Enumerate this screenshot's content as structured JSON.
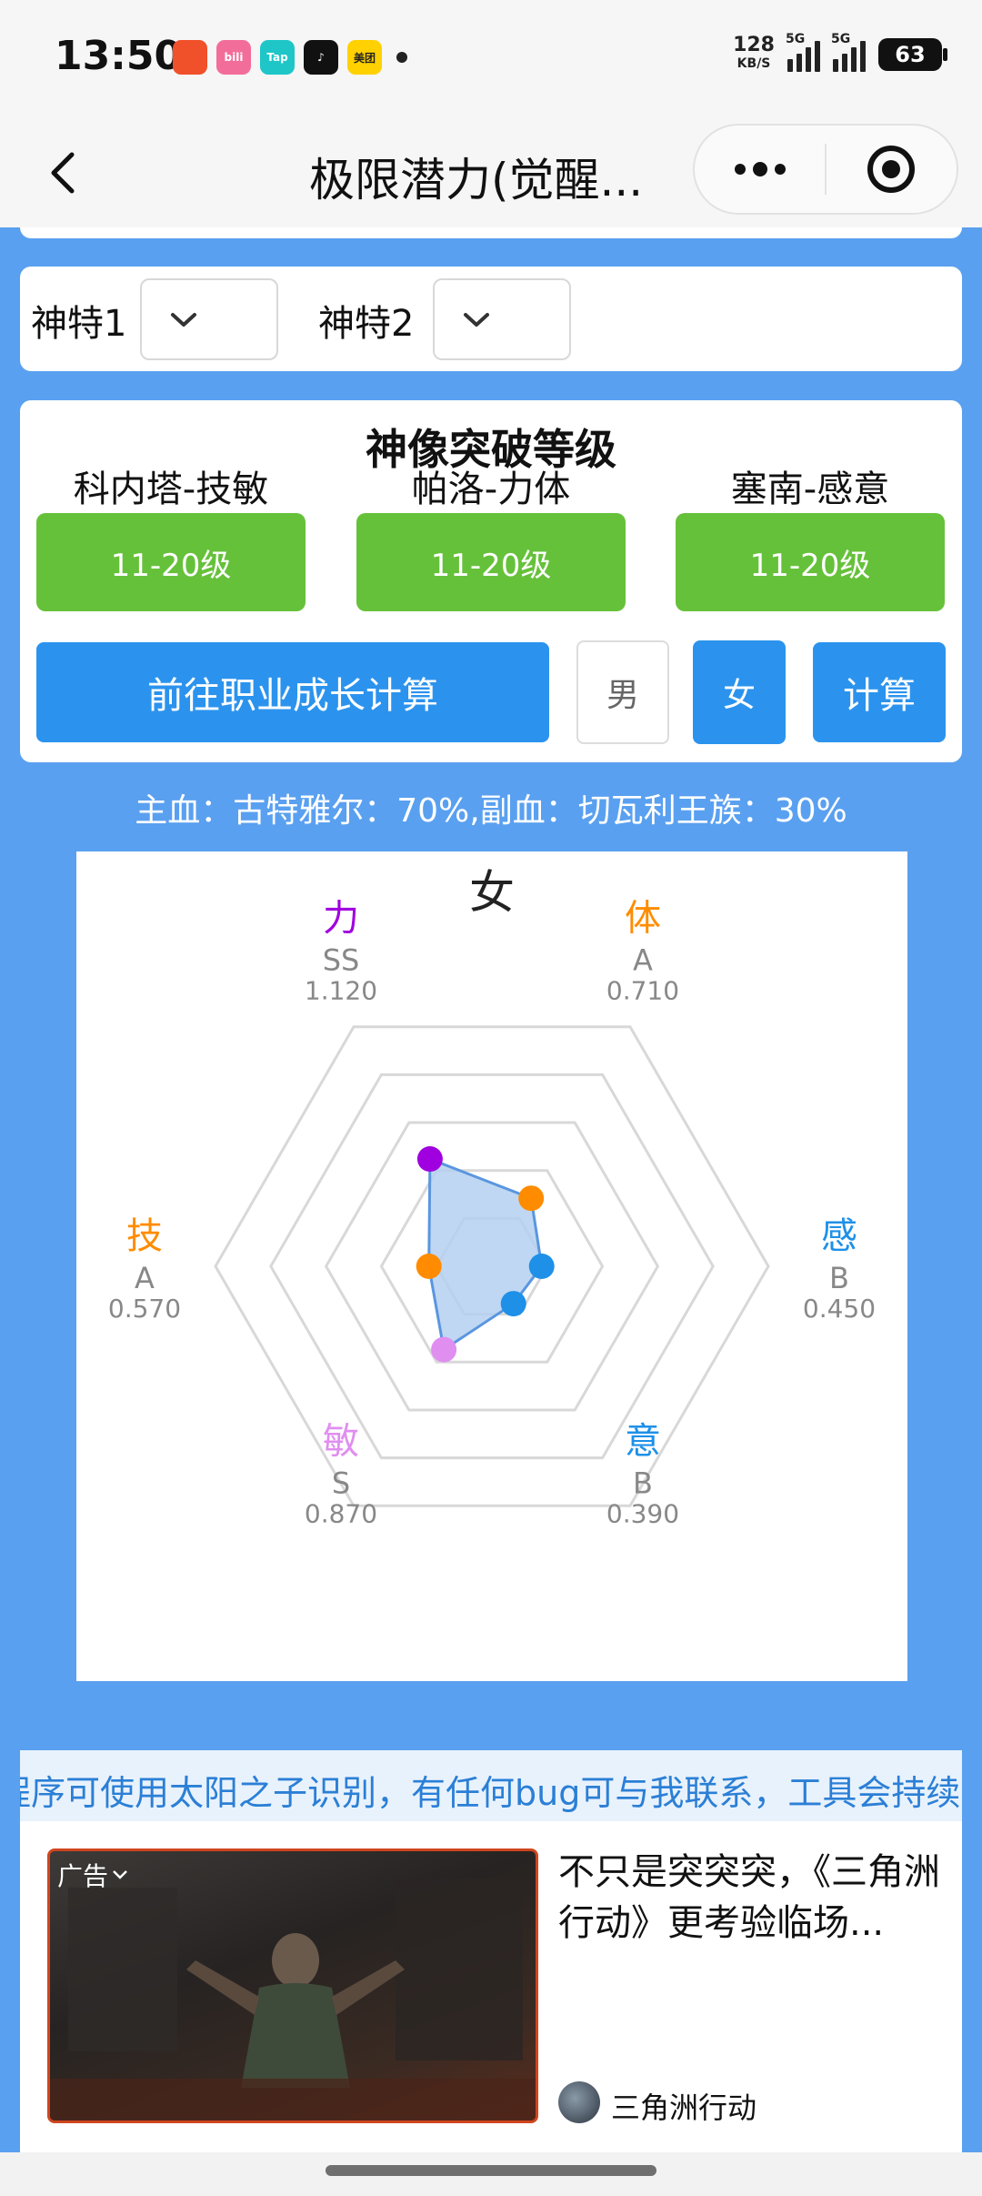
{
  "status_bar": {
    "time": "13:50",
    "apps": [
      {
        "name": "taobao-icon",
        "label": "",
        "color": "#f0502a"
      },
      {
        "name": "bilibili-icon",
        "label": "bili",
        "color": "#f36d9a"
      },
      {
        "name": "taptap-icon",
        "label": "Tap",
        "color": "#1ec6c8"
      },
      {
        "name": "douyin-icon",
        "label": "♪",
        "color": "#111111"
      },
      {
        "name": "meituan-icon",
        "label": "美团",
        "color": "#ffd100"
      }
    ],
    "net_speed_value": "128",
    "net_speed_unit": "KB/S",
    "signal1_tag": "5G",
    "signal2_tag": "5G",
    "battery": "63"
  },
  "title_bar": {
    "title": "极限潜力(觉醒..."
  },
  "gods": {
    "god1_label": "神特1",
    "god2_label": "神特2"
  },
  "statue_break": {
    "title": "神像突破等级",
    "statues": [
      {
        "name": "科内塔-技敏",
        "level": "11-20级"
      },
      {
        "name": "帕洛-力体",
        "level": "11-20级"
      },
      {
        "name": "塞南-感意",
        "level": "11-20级"
      }
    ],
    "career_button": "前往职业成长计算",
    "male": "男",
    "female": "女",
    "calc": "计算"
  },
  "bloodline": "主血：古特雅尔：70%,副血：切瓦利王族：30%",
  "chart_data": {
    "type": "radar",
    "title": "女",
    "axes": [
      {
        "label": "力",
        "grade": "SS",
        "value": 1.12,
        "value_text": "1.120",
        "color": "#a000e0"
      },
      {
        "label": "体",
        "grade": "A",
        "value": 0.71,
        "value_text": "0.710",
        "color": "#ff8c00"
      },
      {
        "label": "感",
        "grade": "B",
        "value": 0.45,
        "value_text": "0.450",
        "color": "#1e90e8"
      },
      {
        "label": "意",
        "grade": "B",
        "value": 0.39,
        "value_text": "0.390",
        "color": "#1e90e8"
      },
      {
        "label": "敏",
        "grade": "S",
        "value": 0.87,
        "value_text": "0.870",
        "color": "#e08ef0"
      },
      {
        "label": "技",
        "grade": "A",
        "value": 0.57,
        "value_text": "0.570",
        "color": "#ff8c00"
      }
    ],
    "rings": 5,
    "max": 2.5,
    "fill_color": "#b4d0f0",
    "line_color": "#5a96e0",
    "grid_color": "#d8d8d8"
  },
  "marquee": "程序可使用太阳之子识别，有任何bug可与我联系，工具会持续更新",
  "ad": {
    "tag": "广告",
    "title": "不只是突突突，《三角洲行动》更考验临场...",
    "source": "三角洲行动"
  }
}
